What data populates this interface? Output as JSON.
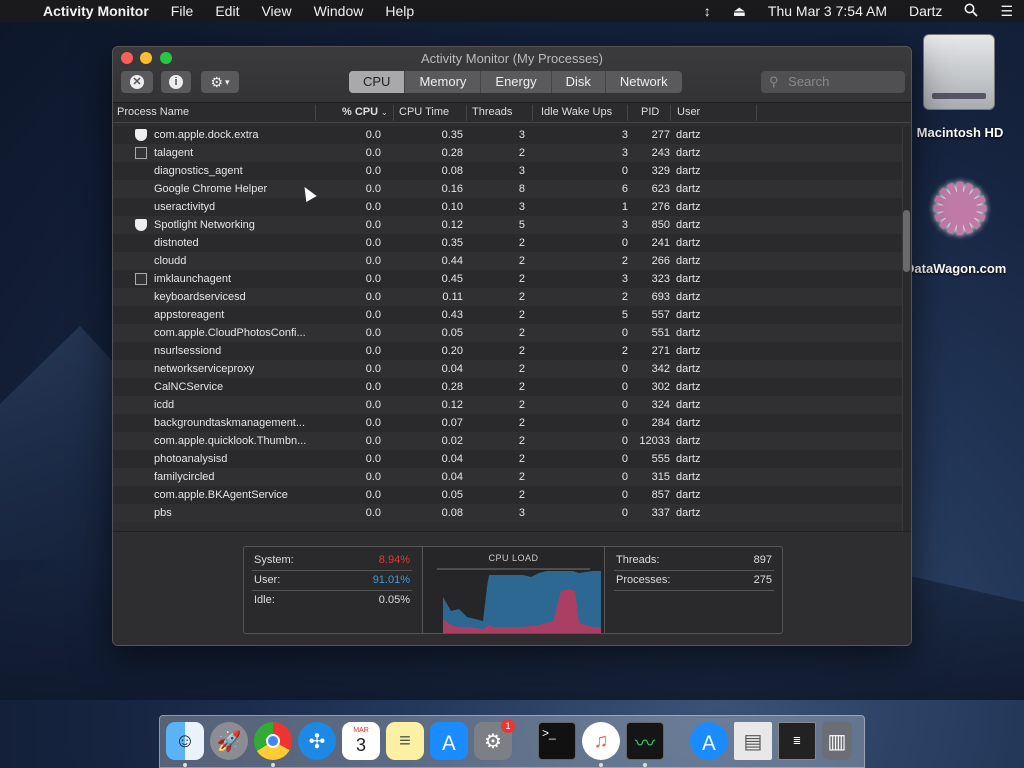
{
  "menubar": {
    "apple": "",
    "app": "Activity Monitor",
    "items": [
      "File",
      "Edit",
      "View",
      "Window",
      "Help"
    ],
    "clock": "Thu Mar 3  7:54 AM",
    "user": "Dartz"
  },
  "desktop": {
    "hd_label": "Macintosh HD",
    "dw_label": "DataWagon.com"
  },
  "window": {
    "title": "Activity Monitor (My Processes)",
    "tabs": [
      "CPU",
      "Memory",
      "Energy",
      "Disk",
      "Network"
    ],
    "active_tab": "CPU",
    "search_placeholder": "Search"
  },
  "columns": {
    "name": "Process Name",
    "cpu": "% CPU",
    "time": "CPU Time",
    "threads": "Threads",
    "wake": "Idle Wake Ups",
    "pid": "PID",
    "user": "User"
  },
  "rows": [
    {
      "icon": "shield",
      "name": "com.apple.dock.extra",
      "cpu": "0.0",
      "time": "0.35",
      "threads": "3",
      "wake": "3",
      "pid": "277",
      "user": "dartz"
    },
    {
      "icon": "window",
      "name": "talagent",
      "cpu": "0.0",
      "time": "0.28",
      "threads": "2",
      "wake": "3",
      "pid": "243",
      "user": "dartz"
    },
    {
      "icon": "",
      "name": "diagnostics_agent",
      "cpu": "0.0",
      "time": "0.08",
      "threads": "3",
      "wake": "0",
      "pid": "329",
      "user": "dartz"
    },
    {
      "icon": "",
      "name": "Google Chrome Helper",
      "cpu": "0.0",
      "time": "0.16",
      "threads": "8",
      "wake": "6",
      "pid": "623",
      "user": "dartz"
    },
    {
      "icon": "",
      "name": "useractivityd",
      "cpu": "0.0",
      "time": "0.10",
      "threads": "3",
      "wake": "1",
      "pid": "276",
      "user": "dartz"
    },
    {
      "icon": "shield",
      "name": "Spotlight Networking",
      "cpu": "0.0",
      "time": "0.12",
      "threads": "5",
      "wake": "3",
      "pid": "850",
      "user": "dartz"
    },
    {
      "icon": "",
      "name": "distnoted",
      "cpu": "0.0",
      "time": "0.35",
      "threads": "2",
      "wake": "0",
      "pid": "241",
      "user": "dartz"
    },
    {
      "icon": "",
      "name": "cloudd",
      "cpu": "0.0",
      "time": "0.44",
      "threads": "2",
      "wake": "2",
      "pid": "266",
      "user": "dartz"
    },
    {
      "icon": "window",
      "name": "imklaunchagent",
      "cpu": "0.0",
      "time": "0.45",
      "threads": "2",
      "wake": "3",
      "pid": "323",
      "user": "dartz"
    },
    {
      "icon": "",
      "name": "keyboardservicesd",
      "cpu": "0.0",
      "time": "0.11",
      "threads": "2",
      "wake": "2",
      "pid": "693",
      "user": "dartz"
    },
    {
      "icon": "",
      "name": "appstoreagent",
      "cpu": "0.0",
      "time": "0.43",
      "threads": "2",
      "wake": "5",
      "pid": "557",
      "user": "dartz"
    },
    {
      "icon": "",
      "name": "com.apple.CloudPhotosConfi...",
      "cpu": "0.0",
      "time": "0.05",
      "threads": "2",
      "wake": "0",
      "pid": "551",
      "user": "dartz"
    },
    {
      "icon": "",
      "name": "nsurlsessiond",
      "cpu": "0.0",
      "time": "0.20",
      "threads": "2",
      "wake": "2",
      "pid": "271",
      "user": "dartz"
    },
    {
      "icon": "",
      "name": "networkserviceproxy",
      "cpu": "0.0",
      "time": "0.04",
      "threads": "2",
      "wake": "0",
      "pid": "342",
      "user": "dartz"
    },
    {
      "icon": "",
      "name": "CalNCService",
      "cpu": "0.0",
      "time": "0.28",
      "threads": "2",
      "wake": "0",
      "pid": "302",
      "user": "dartz"
    },
    {
      "icon": "",
      "name": "icdd",
      "cpu": "0.0",
      "time": "0.12",
      "threads": "2",
      "wake": "0",
      "pid": "324",
      "user": "dartz"
    },
    {
      "icon": "",
      "name": "backgroundtaskmanagement...",
      "cpu": "0.0",
      "time": "0.07",
      "threads": "2",
      "wake": "0",
      "pid": "284",
      "user": "dartz"
    },
    {
      "icon": "",
      "name": "com.apple.quicklook.Thumbn...",
      "cpu": "0.0",
      "time": "0.02",
      "threads": "2",
      "wake": "0",
      "pid": "12033",
      "user": "dartz"
    },
    {
      "icon": "",
      "name": "photoanalysisd",
      "cpu": "0.0",
      "time": "0.04",
      "threads": "2",
      "wake": "0",
      "pid": "555",
      "user": "dartz"
    },
    {
      "icon": "",
      "name": "familycircled",
      "cpu": "0.0",
      "time": "0.04",
      "threads": "2",
      "wake": "0",
      "pid": "315",
      "user": "dartz"
    },
    {
      "icon": "",
      "name": "com.apple.BKAgentService",
      "cpu": "0.0",
      "time": "0.05",
      "threads": "2",
      "wake": "0",
      "pid": "857",
      "user": "dartz"
    },
    {
      "icon": "",
      "name": "pbs",
      "cpu": "0.0",
      "time": "0.08",
      "threads": "3",
      "wake": "0",
      "pid": "337",
      "user": "dartz"
    }
  ],
  "stats": {
    "system_label": "System:",
    "system_value": "8.94%",
    "system_color": "#e0383c",
    "user_label": "User:",
    "user_value": "91.01%",
    "user_color": "#3a9be0",
    "idle_label": "Idle:",
    "idle_value": "0.05%",
    "cpu_load_title": "CPU LOAD",
    "threads_label": "Threads:",
    "threads_value": "897",
    "processes_label": "Processes:",
    "processes_value": "275"
  },
  "dock": {
    "items": [
      "finder-icon",
      "launchpad-icon",
      "chrome-icon",
      "safari-icon",
      "calendar-icon",
      "notes-icon",
      "app-store-icon",
      "system-preferences-icon",
      "terminal-icon",
      "itunes-icon",
      "activity-monitor-icon",
      "app-store-downloads-icon",
      "file-icon",
      "terminal-window-icon",
      "trash-icon"
    ],
    "calendar_month": "MAR",
    "calendar_day": "3",
    "badge": "1"
  }
}
